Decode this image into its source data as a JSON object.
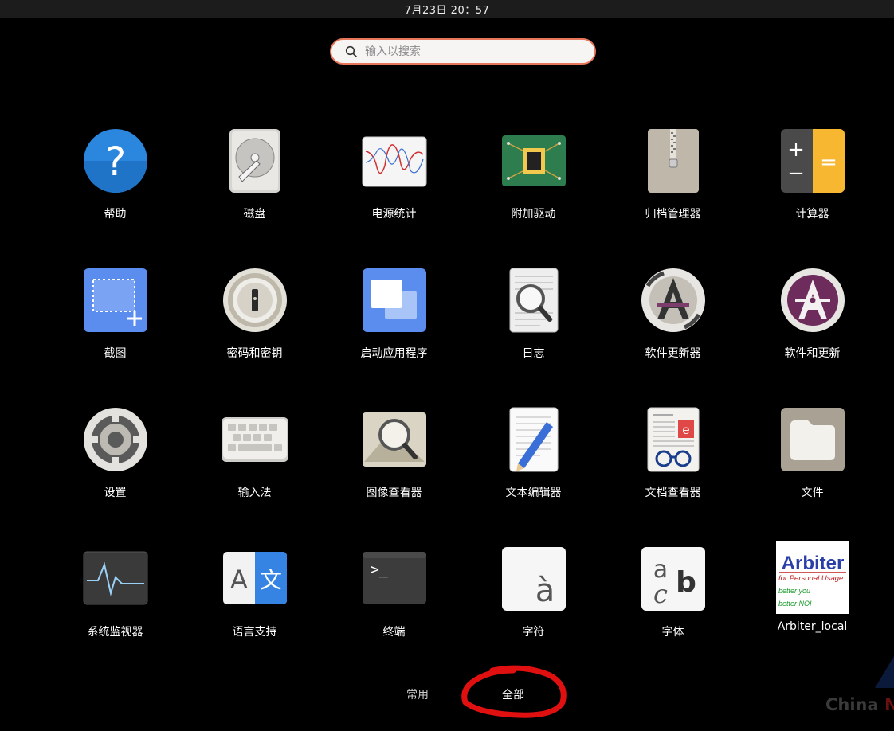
{
  "topbar": {
    "clock": "7月23日  20：57"
  },
  "search": {
    "placeholder": "输入以搜索"
  },
  "apps": [
    {
      "label": "帮助",
      "icon": "help-icon"
    },
    {
      "label": "磁盘",
      "icon": "disk-icon"
    },
    {
      "label": "电源统计",
      "icon": "power-statistics-icon"
    },
    {
      "label": "附加驱动",
      "icon": "additional-drivers-icon"
    },
    {
      "label": "归档管理器",
      "icon": "archive-manager-icon"
    },
    {
      "label": "计算器",
      "icon": "calculator-icon"
    },
    {
      "label": "截图",
      "icon": "screenshot-icon"
    },
    {
      "label": "密码和密钥",
      "icon": "passwords-keys-icon"
    },
    {
      "label": "启动应用程序",
      "icon": "startup-applications-icon"
    },
    {
      "label": "日志",
      "icon": "logs-icon"
    },
    {
      "label": "软件更新器",
      "icon": "software-updater-icon"
    },
    {
      "label": "软件和更新",
      "icon": "software-updates-icon"
    },
    {
      "label": "设置",
      "icon": "settings-icon"
    },
    {
      "label": "输入法",
      "icon": "input-method-icon"
    },
    {
      "label": "图像查看器",
      "icon": "image-viewer-icon"
    },
    {
      "label": "文本编辑器",
      "icon": "text-editor-icon"
    },
    {
      "label": "文档查看器",
      "icon": "document-viewer-icon"
    },
    {
      "label": "文件",
      "icon": "files-icon"
    },
    {
      "label": "系统监视器",
      "icon": "system-monitor-icon"
    },
    {
      "label": "语言支持",
      "icon": "language-support-icon"
    },
    {
      "label": "终端",
      "icon": "terminal-icon"
    },
    {
      "label": "字符",
      "icon": "characters-icon"
    },
    {
      "label": "字体",
      "icon": "fonts-icon"
    },
    {
      "label": "Arbiter_local",
      "icon": "arbiter-logo-icon"
    }
  ],
  "arbiter_logo": {
    "title": "Arbiter",
    "line1": "for Personal Usage",
    "line2": "better you",
    "line3": "better NOI"
  },
  "icon_glyphs": {
    "calc_plus": "+",
    "calc_minus": "−",
    "calc_equals": "=",
    "terminal_prompt": ">_",
    "char_sample": "à",
    "font_a": "a",
    "font_c": "c",
    "font_b": "b",
    "lang_a": "A",
    "lang_wen": "文",
    "help_q": "?"
  },
  "tabs": [
    {
      "label": "常用",
      "active": false
    },
    {
      "label": "全部",
      "active": true
    }
  ],
  "watermark": {
    "text_a": "China ",
    "text_b": "N"
  },
  "colors": {
    "search_border": "#e8765a",
    "annotation_red": "#e01010"
  }
}
